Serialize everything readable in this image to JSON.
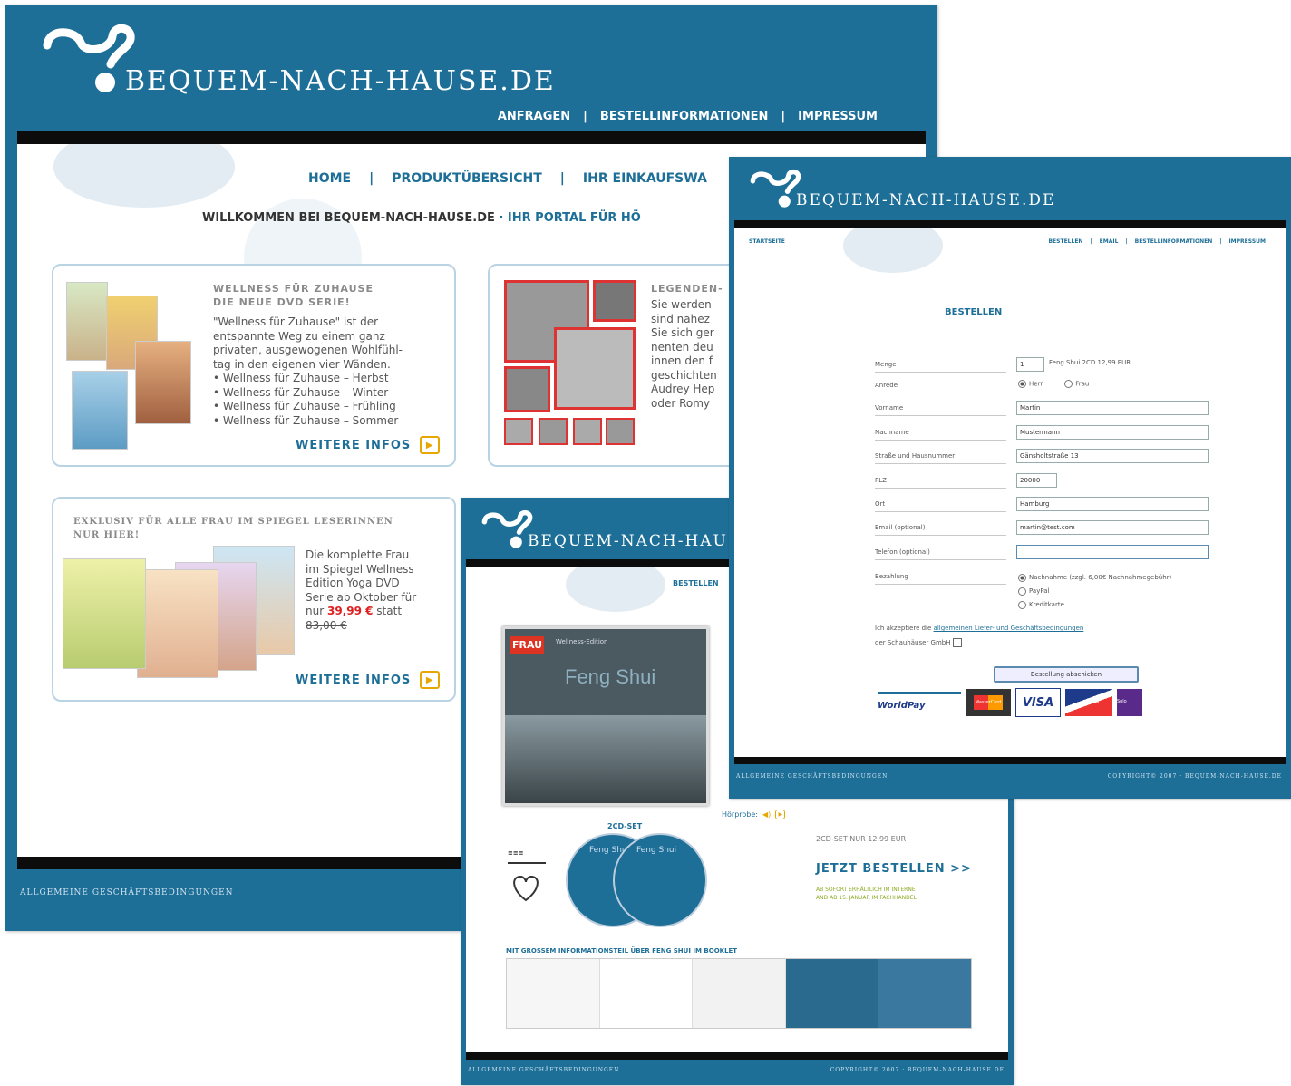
{
  "brand": {
    "name": "BEQUEM-NACH-HAUSE.DE"
  },
  "colors": {
    "primary": "#1e6f98",
    "accent": "#e6a800",
    "price": "#e02020"
  },
  "home_page": {
    "top_nav": [
      "ANFRAGEN",
      "BESTELLINFORMATIONEN",
      "IMPRESSUM"
    ],
    "main_nav": [
      "HOME",
      "PRODUKTÜBERSICHT",
      "IHR EINKAUFSWA"
    ],
    "welcome": "WILLKOMMEN BEI BEQUEM-NACH-HAUSE.DE",
    "welcome_sub": "· IHR PORTAL FÜR HÖ",
    "box1": {
      "title_line1": "WELLNESS FÜR ZUHAUSE",
      "title_line2": "DIE NEUE DVD SERIE!",
      "text_lines": [
        "\"Wellness für Zuhause\" ist der",
        "entspannte Weg zu einem ganz",
        "privaten, ausgewogenen Wohlfühl-",
        "tag in den eigenen vier Wänden."
      ],
      "bullets": [
        "• Wellness für Zuhause – Herbst",
        "• Wellness für Zuhause – Winter",
        "• Wellness für Zuhause – Frühling",
        "• Wellness für Zuhause – Sommer"
      ],
      "more": "WEITERE INFOS"
    },
    "box2": {
      "title": "LEGENDEN-",
      "text_lines": [
        "Sie werden",
        "sind nahez",
        "Sie sich ger",
        "nenten deu",
        "innen den f",
        "geschichten",
        "Audrey Hep",
        "oder Romy"
      ]
    },
    "box3": {
      "title_line1": "EXKLUSIV FÜR ALLE FRAU IM SPIEGEL LESERINNEN",
      "title_line2": "NUR HIER!",
      "text_lines": [
        "Die komplette Frau",
        "im Spiegel Wellness",
        "Edition Yoga DVD",
        "Serie ab Oktober für"
      ],
      "price_prefix": "nur",
      "price": "39,99 €",
      "price_suffix": "statt",
      "old_price": "83,00 €",
      "more": "WEITERE INFOS"
    },
    "footer": "ALLGEMEINE GESCHÄFTSBEDINGUNGEN"
  },
  "product_page": {
    "nav": "BESTELLEN",
    "cd_label": "FRAU",
    "cd_subtitle": "Wellness-Edition",
    "cd_title": "Feng Shui",
    "set_label": "2CD-SET",
    "disc_titles": [
      "Feng Shui",
      "Feng Shui"
    ],
    "price_text": "2CD-SET NUR 12,99 EUR",
    "order_cta": "JETZT BESTELLEN >>",
    "delivery_text": [
      "AB SOFORT ERHÄLTLICH IM INTERNET",
      "AND AB 15. JANUAR IM FACHHANDEL"
    ],
    "sample_label": "Hörprobe:",
    "booklet_caption": "MIT GROSSEM INFORMATIONSTEIL ÜBER FENG SHUI IM BOOKLET",
    "footer_left": "ALLGEMEINE GESCHÄFTSBEDINGUNGEN",
    "footer_right": "COPYRIGHT© 2007 · BEQUEM-NACH-HAUSE.DE"
  },
  "order_page": {
    "breadcrumb": "STARTSEITE",
    "top_nav": [
      "BESTELLEN",
      "EMAIL",
      "BESTELLINFORMATIONEN",
      "IMPRESSUM"
    ],
    "heading": "BESTELLEN",
    "fields": {
      "menge": {
        "label": "Menge",
        "value": "1",
        "suffix": "Feng Shui 2CD 12,99 EUR"
      },
      "anrede": {
        "label": "Anrede",
        "options": [
          "Herr",
          "Frau"
        ],
        "selected": "Herr"
      },
      "vorname": {
        "label": "Vorname",
        "value": "Martin"
      },
      "nachname": {
        "label": "Nachname",
        "value": "Mustermann"
      },
      "strasse": {
        "label": "Straße und Hausnummer",
        "value": "Gänsholtstraße 13"
      },
      "plz": {
        "label": "PLZ",
        "value": "20000"
      },
      "ort": {
        "label": "Ort",
        "value": "Hamburg"
      },
      "email": {
        "label": "Email (optional)",
        "value": "martin@test.com"
      },
      "telefon": {
        "label": "Telefon (optional)",
        "value": ""
      },
      "bezahlung": {
        "label": "Bezahlung",
        "options": [
          "Nachnahme (zzgl. 6,00€ Nachnahmegebühr)",
          "PayPal",
          "Kreditkarte"
        ],
        "selected": "Nachnahme (zzgl. 6,00€ Nachnahmegebühr)"
      }
    },
    "agb_text_1": "Ich akzeptiere die",
    "agb_link": "allgemeinen Liefer- und Geschäftsbedingungen",
    "agb_text_2": "der Schauhäuser GmbH",
    "submit": "Bestellung abschicken",
    "payment_logos": [
      "WorldPay",
      "MasterCard",
      "VISA",
      "Delta",
      "Solo"
    ],
    "footer_left": "ALLGEMEINE GESCHÄFTSBEDINGUNGEN",
    "footer_right": "COPYRIGHT© 2007 · BEQUEM-NACH-HAUSE.DE"
  }
}
